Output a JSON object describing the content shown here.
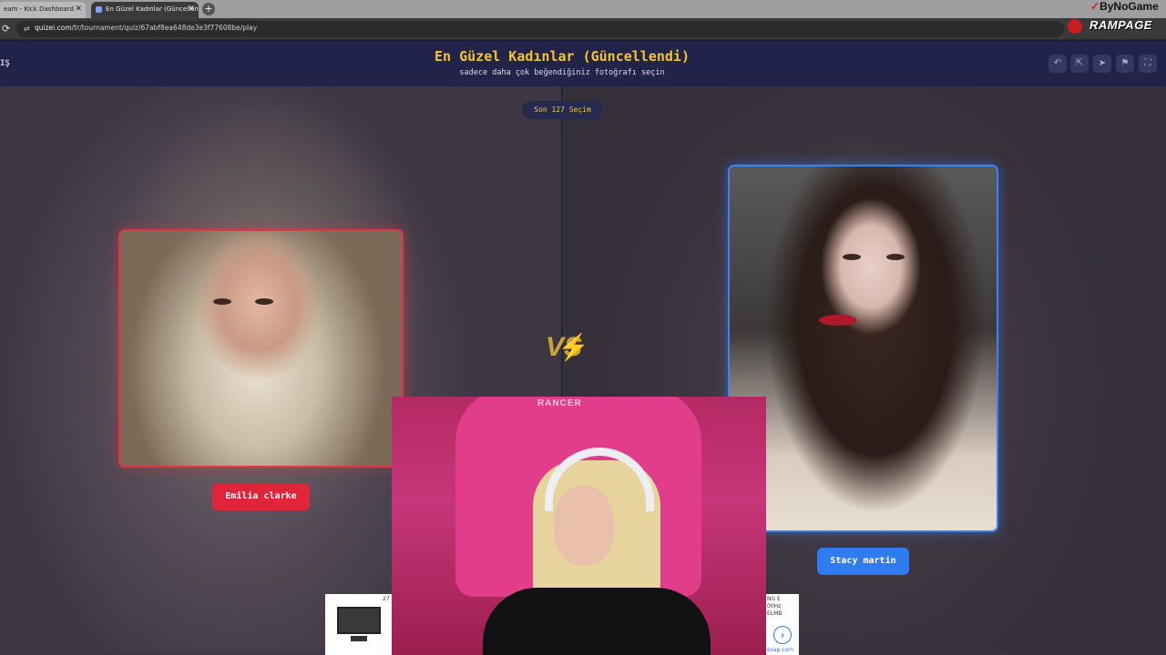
{
  "browser": {
    "tabs": [
      {
        "label": "eam - Kick Dashboard",
        "close": "✕"
      },
      {
        "label": "En Güzel Kadınlar (Güncellendi",
        "close": "✕"
      }
    ],
    "new_tab": "+",
    "url_host": "quizei.com",
    "url_path": "/tr/tournament/quiz/67abf8ea648de3e3f77608be/play",
    "reload_icon": "reload-icon"
  },
  "overlay": {
    "brand_top": "ByNoGame",
    "brand_bottom": "RAMPAGE"
  },
  "header": {
    "left_text": "IŞ",
    "title": "En Güzel Kadınlar (Güncellendi)",
    "subtitle": "sadece daha çok beğendiğiniz fotoğrafı seçin",
    "buttons": [
      {
        "icon": "undo-icon",
        "glyph": "↶"
      },
      {
        "icon": "share-icon",
        "glyph": "⇱"
      },
      {
        "icon": "send-icon",
        "glyph": "➤"
      },
      {
        "icon": "flag-icon",
        "glyph": "⚑"
      },
      {
        "icon": "fullscreen-icon",
        "glyph": "⛶"
      }
    ]
  },
  "match": {
    "counter": "Son 127 Seçim",
    "vs": "VS",
    "left": {
      "name": "Emilia clarke",
      "accent": "#e0253a"
    },
    "right": {
      "name": "Stacy martin",
      "accent": "#2f7bf1"
    }
  },
  "webcam": {
    "chair_brand": "RANCER"
  },
  "ads": {
    "left_tag": "27",
    "right_lines": [
      "NG  E",
      "00Hz",
      "ELMB",
      "esap.com"
    ]
  },
  "colors": {
    "header_bg": "#22234a",
    "title": "#f4c433",
    "left_accent": "#e63245",
    "right_accent": "#3b82f6"
  }
}
